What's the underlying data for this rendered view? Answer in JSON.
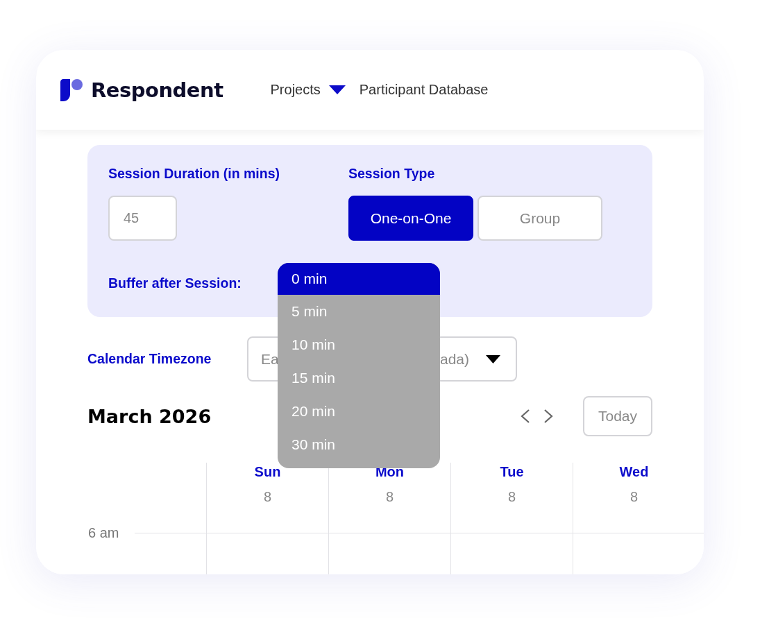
{
  "header": {
    "brand": "Respondent",
    "nav": [
      {
        "label": "Projects",
        "kind": "menu"
      },
      {
        "label": "Participant Database",
        "kind": "link"
      }
    ]
  },
  "settings": {
    "duration_label": "Session Duration (in mins)",
    "duration_value": "45",
    "type_label": "Session Type",
    "session_types": [
      {
        "label": "One-on-One",
        "selected": true
      },
      {
        "label": "Group",
        "selected": false
      }
    ],
    "buffer_label": "Buffer after Session:",
    "buffer_options": [
      {
        "label": "0 min",
        "selected": true
      },
      {
        "label": "5 min",
        "selected": false
      },
      {
        "label": "10 min",
        "selected": false
      },
      {
        "label": "15 min",
        "selected": false
      },
      {
        "label": "20 min",
        "selected": false
      },
      {
        "label": "30 min",
        "selected": false
      }
    ]
  },
  "timezone": {
    "label": "Calendar Timezone",
    "value_start": "Ea",
    "value_end": "ada)"
  },
  "calendar": {
    "month": "March 2026",
    "today_button": "Today",
    "days": [
      {
        "name": "Sun",
        "date": "8"
      },
      {
        "name": "Mon",
        "date": "8"
      },
      {
        "name": "Tue",
        "date": "8"
      },
      {
        "name": "Wed",
        "date": "8"
      }
    ],
    "hours": [
      "6 am"
    ]
  }
}
